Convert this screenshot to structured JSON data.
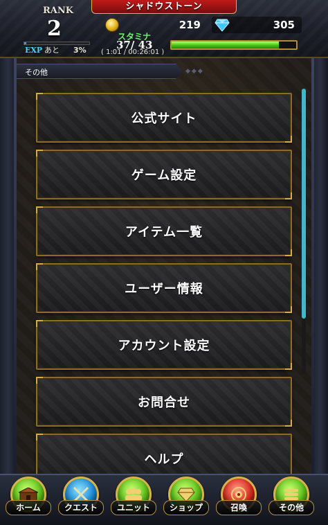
{
  "header": {
    "title": "シャドウストーン",
    "rank_label": "RANK",
    "rank_value": "2",
    "exp_label": "EXP",
    "exp_remaining_label": "あと",
    "exp_percent": "3%",
    "exp_progress": 0.03,
    "coins": "219",
    "gems": "305",
    "stamina_label": "スタミナ",
    "stamina_value": "37/ 43",
    "stamina_timer": "( 1:01 / 00:26:01 )",
    "stamina_progress": 0.86
  },
  "section": {
    "label": "その他"
  },
  "menu": [
    {
      "label": "公式サイト"
    },
    {
      "label": "ゲーム設定"
    },
    {
      "label": "アイテム一覧"
    },
    {
      "label": "ユーザー情報"
    },
    {
      "label": "アカウント設定"
    },
    {
      "label": "お問合せ"
    },
    {
      "label": "ヘルプ"
    }
  ],
  "nav": [
    {
      "label": "ホーム",
      "icon": "home-icon",
      "color": "green"
    },
    {
      "label": "クエスト",
      "icon": "swords-icon",
      "color": "blue"
    },
    {
      "label": "ユニット",
      "icon": "party-icon",
      "color": "green"
    },
    {
      "label": "ショップ",
      "icon": "gem-icon",
      "color": "green"
    },
    {
      "label": "召喚",
      "icon": "summon-icon",
      "color": "red"
    },
    {
      "label": "その他",
      "icon": "menu-icon",
      "color": "green"
    }
  ],
  "colors": {
    "accent_gold": "#d8aa48",
    "stamina_green": "#42c21a",
    "exp_blue": "#2d9bff",
    "title_red": "#c01a1a",
    "scrollbar": "#3fb8c8"
  }
}
